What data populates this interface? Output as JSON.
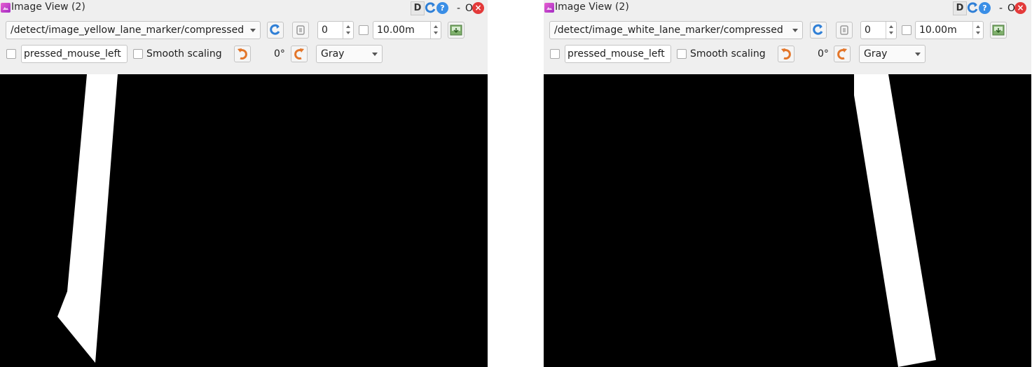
{
  "panels": [
    {
      "title": "Image View (2)",
      "window_buttons": {
        "d": "D",
        "help": "?",
        "minimize": "-",
        "float": "O",
        "close": "×"
      },
      "topic": "/detect/image_yellow_lane_marker/compressed",
      "spin_value": "0",
      "max_range": "10.00m",
      "mouse_topic": "pressed_mouse_left",
      "smooth_scaling_label": "Smooth scaling",
      "rotation": "0°",
      "color_scheme": "Gray"
    },
    {
      "title": "Image View (2)",
      "window_buttons": {
        "d": "D",
        "help": "?",
        "minimize": "-",
        "float": "O",
        "close": "×"
      },
      "topic": "/detect/image_white_lane_marker/compressed",
      "spin_value": "0",
      "max_range": "10.00m",
      "mouse_topic": "pressed_mouse_left",
      "smooth_scaling_label": "Smooth scaling",
      "rotation": "0°",
      "color_scheme": "Gray"
    }
  ],
  "colors": {
    "background": "#efefef",
    "image_background": "#000000",
    "lane_marker": "#ffffff",
    "refresh_icon": "#2f7fd6",
    "rotate_icon": "#e3762a"
  }
}
